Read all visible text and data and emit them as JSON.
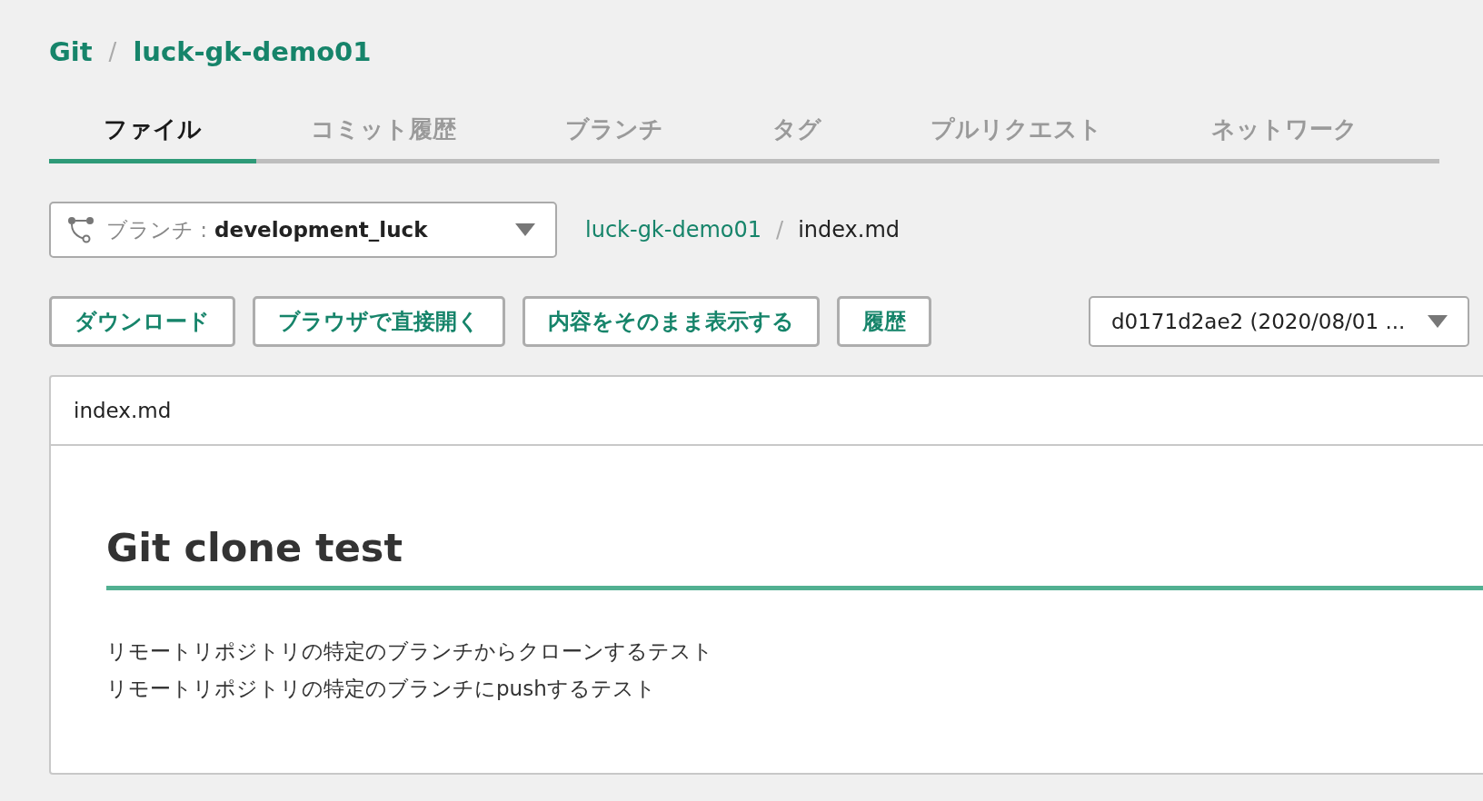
{
  "breadcrumb": {
    "items": [
      "Git",
      "luck-gk-demo01"
    ],
    "separator": "/"
  },
  "tabs": [
    {
      "label": "ファイル",
      "selected": true
    },
    {
      "label": "コミット履歴",
      "selected": false
    },
    {
      "label": "ブランチ",
      "selected": false
    },
    {
      "label": "タグ",
      "selected": false
    },
    {
      "label": "プルリクエスト",
      "selected": false
    },
    {
      "label": "ネットワーク",
      "selected": false
    }
  ],
  "branch_select": {
    "label": "ブランチ :",
    "value": "development_luck"
  },
  "file_path": {
    "items": [
      {
        "label": "luck-gk-demo01",
        "kind": "link"
      },
      {
        "label": "index.md",
        "kind": "current"
      }
    ],
    "separator": "/"
  },
  "buttons": [
    "ダウンロード",
    "ブラウザで直接開く",
    "内容をそのまま表示する",
    "履歴"
  ],
  "commit_select": {
    "value": "d0171d2ae2 (2020/08/01 ..."
  },
  "file_view": {
    "filename": "index.md",
    "heading": "Git clone test",
    "lines": [
      "リモートリポジトリの特定のブランチからクローンするテスト",
      "リモートリポジトリの特定のブランチにpushするテスト"
    ]
  }
}
